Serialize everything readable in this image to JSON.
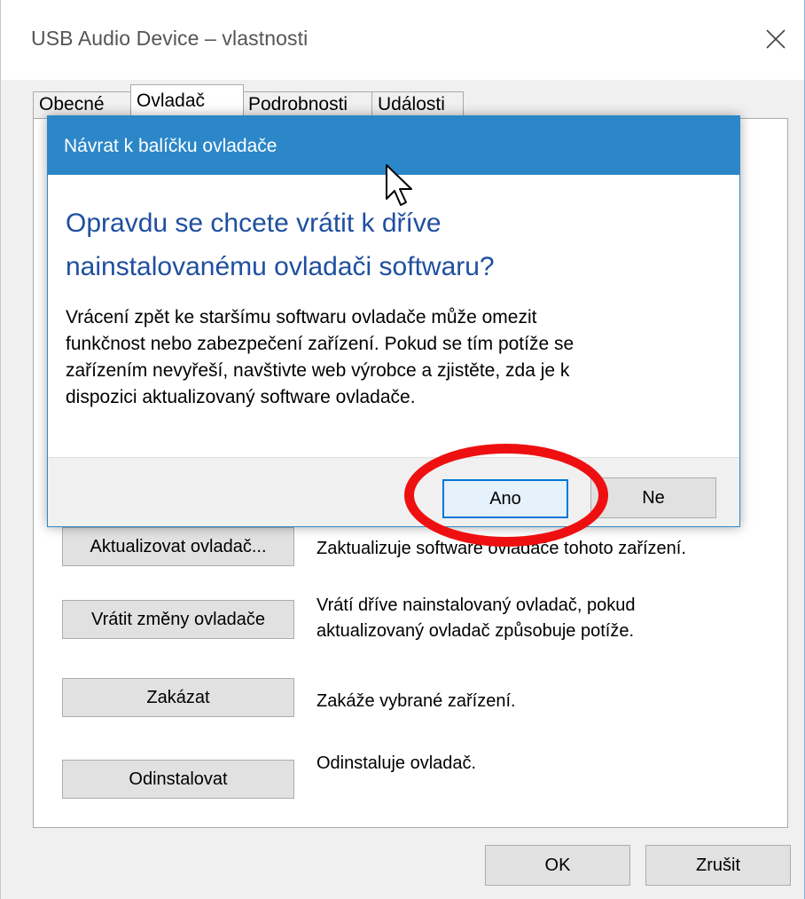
{
  "window": {
    "title": "USB Audio Device – vlastnosti",
    "close_icon": "close-icon"
  },
  "tabs": [
    {
      "label": "Obecné"
    },
    {
      "label": "Ovladač",
      "active": true
    },
    {
      "label": "Podrobnosti"
    },
    {
      "label": "Události"
    }
  ],
  "actions": {
    "update": {
      "label": "Aktualizovat ovladač...",
      "description": "Zaktualizuje software ovladače tohoto zařízení."
    },
    "rollback": {
      "label": "Vrátit změny ovladače",
      "description_line1": "Vrátí dříve nainstalovaný ovladač, pokud",
      "description_line2": "aktualizovaný ovladač způsobuje potíže."
    },
    "disable": {
      "label": "Zakázat",
      "description": "Zakáže vybrané zařízení."
    },
    "uninstall": {
      "label": "Odinstalovat",
      "description": "Odinstaluje ovladač."
    }
  },
  "footer": {
    "ok_label": "OK",
    "cancel_label": "Zrušit"
  },
  "dialog": {
    "title": "Návrat k balíčku ovladače",
    "heading_line1": "Opravdu se chcete vrátit k dříve",
    "heading_line2": "nainstalovanému ovladači softwaru?",
    "body_line1": "Vrácení zpět ke staršímu softwaru ovladače může omezit",
    "body_line2": "funkčnost nebo zabezpečení zařízení. Pokud se tím potíže se",
    "body_line3": "zařízením nevyřeší, navštivte web výrobce a zjistěte, zda je k",
    "body_line4": "dispozici aktualizovaný software ovladače.",
    "yes_label": "Ano",
    "no_label": "Ne"
  },
  "colors": {
    "dialog_header": "#2b87c8",
    "heading_text": "#1f4fa0",
    "highlight_ring": "#ee1010"
  }
}
